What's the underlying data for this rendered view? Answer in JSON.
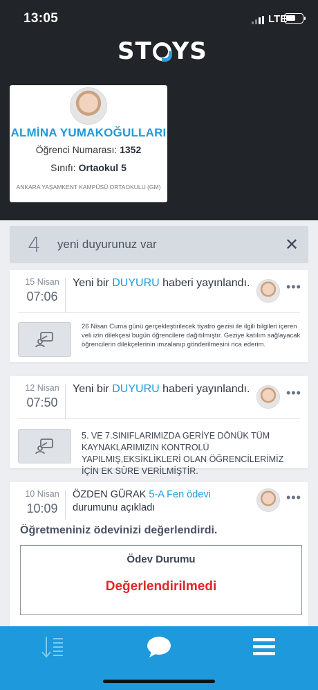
{
  "status_bar": {
    "time": "13:05",
    "network": "LTE"
  },
  "brand": {
    "logo_text_left": "ST",
    "logo_text_right": "YS"
  },
  "student": {
    "name": "ALMİNA YUMAKOĞULLARI",
    "number_label": "Öğrenci Numarası:",
    "number": "1352",
    "class_label": "Sınıfı:",
    "class": "Ortaokul 5",
    "school": "ANKARA YAŞAMKENT KAMPÜSÜ ORTAOKULU (GM)"
  },
  "banner": {
    "count": "4",
    "text": "yeni duyurunuz var",
    "close_label": "✕"
  },
  "notifications": [
    {
      "day": "15 Nisan",
      "time": "07:06",
      "headline_before": "Yeni bir",
      "headline_link": "DUYURU",
      "headline_after": "haberi yayınlandı.",
      "body": "26 Nisan Cuma günü gerçekleştirilecek tiyatro gezisi ile ilgili bilgileri içeren veli izin dilekçesi bugün öğrencilere dağıtılmıştır. Geziye katılım sağlayacak öğrencilerin dilekçelerinin imzalanıp gönderilmesini rica ederim."
    },
    {
      "day": "12 Nisan",
      "time": "07:50",
      "headline_before": "Yeni bir",
      "headline_link": "DUYURU",
      "headline_after": "haberi yayınlandı.",
      "body": "5. VE 7.SINIFLARIMIZDA GERİYE DÖNÜK TÜM KAYNAKLARIMIZIN KONTROLÜ YAPILMIŞ,EKSİKLİKLERİ OLAN ÖĞRENCİLERİMİZ İÇİN EK SÜRE VERİLMİŞTİR."
    },
    {
      "day": "10 Nisan",
      "time": "10:09",
      "headline_before": "ÖZDEN GÜRAK",
      "headline_link": "5-A Fen ödev",
      "headline_link2": "i",
      "headline_after": "durumunu açıkladı",
      "message": "Öğretmeniniz ödevinizi değerlendirdi.",
      "status_title": "Ödev Durumu",
      "status_value": "Değerlendirilmedi"
    }
  ],
  "more_label": "•••",
  "colors": {
    "accent": "#1f9ad6",
    "header_bg": "#212429",
    "nav_bg": "#1d99dc",
    "status_red": "#e2252d"
  },
  "bottom_nav": [
    {
      "icon": "sort-list-icon"
    },
    {
      "icon": "chat-bubble-icon"
    },
    {
      "icon": "hamburger-menu-icon"
    }
  ]
}
